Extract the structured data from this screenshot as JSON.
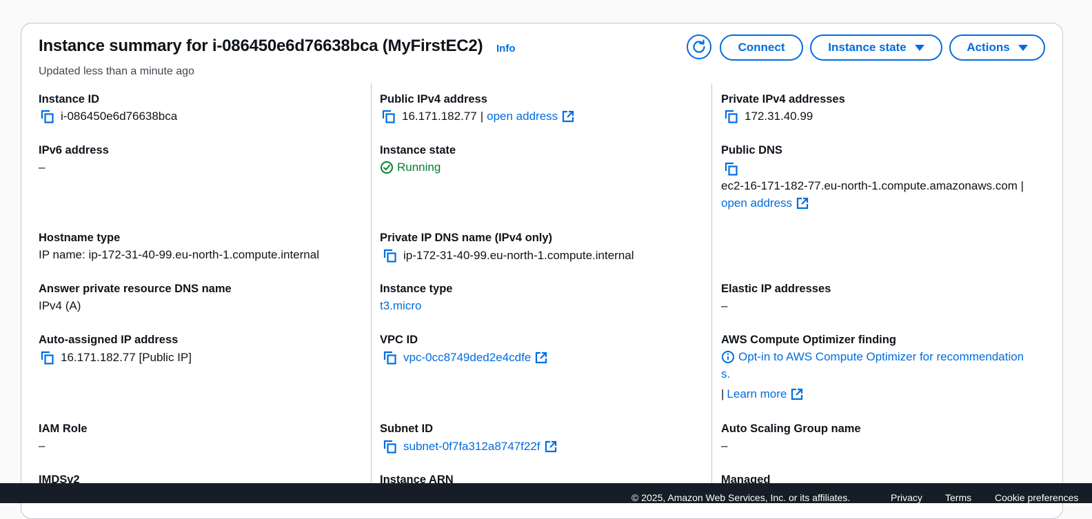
{
  "header": {
    "title": "Instance summary for i-086450e6d76638bca (MyFirstEC2)",
    "info": "Info",
    "updated": "Updated less than a minute ago",
    "buttons": {
      "connect": "Connect",
      "instance_state": "Instance state",
      "actions": "Actions"
    }
  },
  "col1": {
    "instance_id": {
      "label": "Instance ID",
      "value": "i-086450e6d76638bca"
    },
    "ipv6": {
      "label": "IPv6 address",
      "value": "–"
    },
    "hostname_type": {
      "label": "Hostname type",
      "value": "IP name: ip-172-31-40-99.eu-north-1.compute.internal"
    },
    "answer_dns": {
      "label": "Answer private resource DNS name",
      "value": "IPv4 (A)"
    },
    "auto_ip": {
      "label": "Auto-assigned IP address",
      "value": "16.171.182.77 [Public IP]"
    },
    "iam_role": {
      "label": "IAM Role",
      "value": "–"
    },
    "imdsv2": {
      "label": "IMDSv2"
    }
  },
  "col2": {
    "public_ipv4": {
      "label": "Public IPv4 address",
      "value": "16.171.182.77",
      "sep": "|",
      "link": "open address"
    },
    "instance_state": {
      "label": "Instance state",
      "value": "Running"
    },
    "private_dns": {
      "label": "Private IP DNS name (IPv4 only)",
      "value": "ip-172-31-40-99.eu-north-1.compute.internal"
    },
    "instance_type": {
      "label": "Instance type",
      "value": "t3.micro"
    },
    "vpc_id": {
      "label": "VPC ID",
      "value": "vpc-0cc8749ded2e4cdfe"
    },
    "subnet_id": {
      "label": "Subnet ID",
      "value": "subnet-0f7fa312a8747f22f"
    },
    "instance_arn": {
      "label": "Instance ARN"
    }
  },
  "col3": {
    "private_ipv4": {
      "label": "Private IPv4 addresses",
      "value": "172.31.40.99"
    },
    "public_dns": {
      "label": "Public DNS",
      "value": "ec2-16-171-182-77.eu-north-1.compute.amazonaws.com |",
      "link": "open address"
    },
    "elastic_ip": {
      "label": "Elastic IP addresses",
      "value": "–"
    },
    "optimizer": {
      "label": "AWS Compute Optimizer finding",
      "line1": "Opt-in to AWS Compute Optimizer for recommendation",
      "line2": "s.",
      "sep": "|",
      "learn": "Learn more"
    },
    "asg": {
      "label": "Auto Scaling Group name",
      "value": "–"
    },
    "managed": {
      "label": "Managed"
    }
  },
  "footer": {
    "copyright": "© 2025, Amazon Web Services, Inc. or its affiliates.",
    "privacy": "Privacy",
    "terms": "Terms",
    "cookie": "Cookie preferences"
  },
  "colors": {
    "link": "#006ce0",
    "success": "#00802f",
    "border": "#c6c6cd",
    "footer_bg": "#161d26"
  }
}
